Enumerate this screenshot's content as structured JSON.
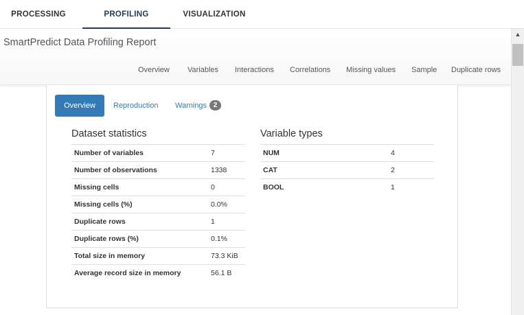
{
  "tabs": [
    "PROCESSING",
    "PROFILING",
    "VISUALIZATION"
  ],
  "report": {
    "title": "SmartPredict Data Profiling Report",
    "nav": [
      "Overview",
      "Variables",
      "Interactions",
      "Correlations",
      "Missing values",
      "Sample",
      "Duplicate rows"
    ]
  },
  "overview": {
    "pills": [
      "Overview",
      "Reproduction",
      "Warnings"
    ],
    "warnings_count": "2",
    "stats_title": "Dataset statistics",
    "stats": [
      {
        "k": "Number of variables",
        "v": "7"
      },
      {
        "k": "Number of observations",
        "v": "1338"
      },
      {
        "k": "Missing cells",
        "v": "0"
      },
      {
        "k": "Missing cells (%)",
        "v": "0.0%"
      },
      {
        "k": "Duplicate rows",
        "v": "1"
      },
      {
        "k": "Duplicate rows (%)",
        "v": "0.1%"
      },
      {
        "k": "Total size in memory",
        "v": "73.3 KiB"
      },
      {
        "k": "Average record size in memory",
        "v": "56.1 B"
      }
    ],
    "types_title": "Variable types",
    "types": [
      {
        "k": "NUM",
        "v": "4"
      },
      {
        "k": "CAT",
        "v": "2"
      },
      {
        "k": "BOOL",
        "v": "1"
      }
    ]
  },
  "scrollbar": {
    "up_glyph": "▲"
  },
  "colors": {
    "active_pill": "#337ab7",
    "tab_active": "#1d3b5e",
    "badge": "#777777"
  }
}
